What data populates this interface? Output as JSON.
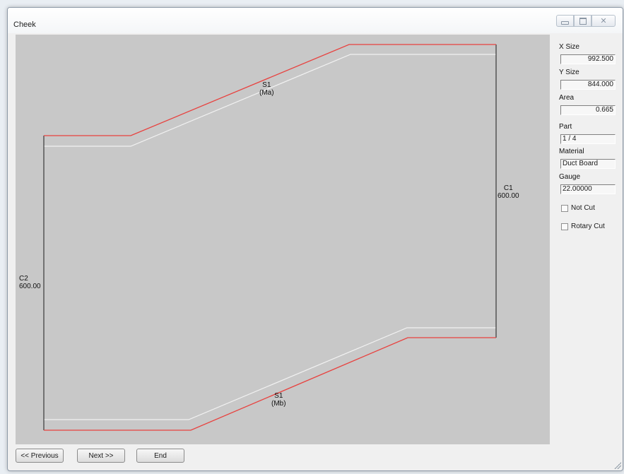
{
  "window": {
    "title": "Cheek"
  },
  "panel": {
    "x_size_label": "X Size",
    "x_size_value": "992.500",
    "y_size_label": "Y Size",
    "y_size_value": "844.000",
    "area_label": "Area",
    "area_value": "0.665",
    "part_label": "Part",
    "part_value": "1 / 4",
    "material_label": "Material",
    "material_value": "Duct Board",
    "gauge_label": "Gauge",
    "gauge_value": "22.00000",
    "not_cut_label": "Not Cut",
    "not_cut_checked": false,
    "rotary_cut_label": "Rotary Cut",
    "rotary_cut_checked": false
  },
  "drawing": {
    "top_edge_name": "S1",
    "top_edge_sub": "(Ma)",
    "bottom_edge_name": "S1",
    "bottom_edge_sub": "(Mb)",
    "right_edge_name": "C1",
    "right_edge_value": "600.00",
    "left_edge_name": "C2",
    "left_edge_value": "600.00"
  },
  "buttons": {
    "previous": "<< Previous",
    "next": "Next >>",
    "end": "End"
  },
  "colors": {
    "cut_line": "#e8413e",
    "offset_line": "#f2f2f2",
    "canvas_bg": "#c8c8c8"
  }
}
